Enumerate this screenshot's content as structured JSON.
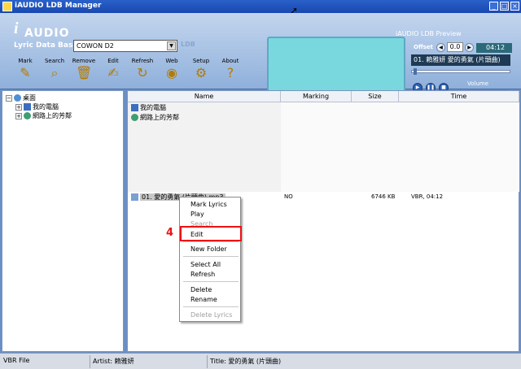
{
  "window": {
    "title": "iAUDIO LDB Manager"
  },
  "header": {
    "logo_i": "i",
    "logo_text": "AUDIO",
    "ldb_label": "Lyric Data Base",
    "device": "COWON D2",
    "ldb_mark": "LDB"
  },
  "toolbar": {
    "mark": "Mark",
    "search": "Search",
    "remove": "Remove",
    "edit": "Edit",
    "refresh": "Refresh",
    "web": "Web",
    "setup": "Setup",
    "about": "About"
  },
  "preview": {
    "title": "iAUDIO LDB Preview",
    "offset_label": "Offset",
    "offset_value": "0.0",
    "time": "04:12",
    "track": "01. 賴雅妍 愛的勇氣 (片頭曲)",
    "volume_label": "Volume"
  },
  "tree": {
    "root": "桌面",
    "items": [
      "我的電腦",
      "網路上的芳鄰"
    ]
  },
  "files": {
    "columns": [
      "Name",
      "Marking",
      "Size",
      "Time"
    ],
    "folders": [
      "我的電腦",
      "網路上的芳鄰"
    ],
    "file": {
      "name": "01. 愛的勇氣 (片頭曲).mp3",
      "marking": "NO",
      "size": "6746 KB",
      "time": "VBR, 04:12"
    }
  },
  "context_menu": {
    "mark_lyrics": "Mark Lyrics",
    "play": "Play",
    "search": "Search",
    "edit": "Edit",
    "new_folder": "New Folder",
    "select_all": "Select All",
    "refresh": "Refresh",
    "delete": "Delete",
    "rename": "Rename",
    "delete_lyrics": "Delete Lyrics"
  },
  "callout": {
    "number": "4",
    "color": "#e11111"
  },
  "status": {
    "type": "VBR File",
    "artist": "Artist: 賴雅妍",
    "title": "Title: 愛的勇氣 (片頭曲)"
  }
}
